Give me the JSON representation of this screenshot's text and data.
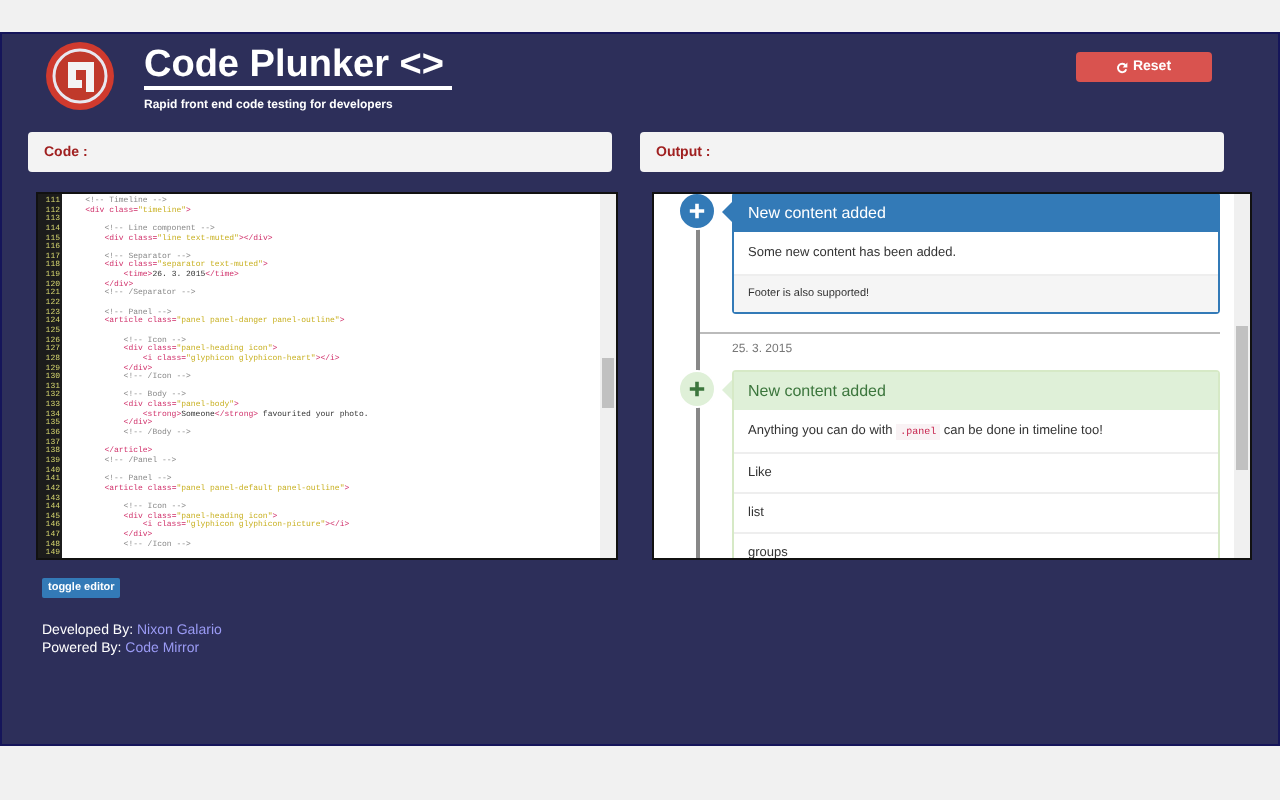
{
  "header": {
    "title": "Code Plunker <>",
    "subtitle": "Rapid front end code testing for developers",
    "reset_button": "Reset"
  },
  "sections": {
    "code_label": "Code :",
    "output_label": "Output :"
  },
  "editor": {
    "lines": [
      {
        "number": "111",
        "tokens": [
          {
            "kind": "comment",
            "text": "    <!-- Timeline -->"
          }
        ]
      },
      {
        "number": "112",
        "tokens": [
          {
            "kind": "tag",
            "text": "    <div "
          },
          {
            "kind": "attr",
            "text": "class="
          },
          {
            "kind": "string",
            "text": "\"timeline\""
          },
          {
            "kind": "tag",
            "text": ">"
          }
        ]
      },
      {
        "number": "113"
      },
      {
        "number": "114",
        "tokens": [
          {
            "kind": "comment",
            "text": "        <!-- Line component -->"
          }
        ]
      },
      {
        "number": "115",
        "tokens": [
          {
            "kind": "tag",
            "text": "        <div "
          },
          {
            "kind": "attr",
            "text": "class="
          },
          {
            "kind": "string",
            "text": "\"line text-muted\""
          },
          {
            "kind": "tag",
            "text": "></div>"
          }
        ]
      },
      {
        "number": "116"
      },
      {
        "number": "117",
        "tokens": [
          {
            "kind": "comment",
            "text": "        <!-- Separator -->"
          }
        ]
      },
      {
        "number": "118",
        "tokens": [
          {
            "kind": "tag",
            "text": "        <div "
          },
          {
            "kind": "attr",
            "text": "class="
          },
          {
            "kind": "string",
            "text": "\"separator text-muted\""
          },
          {
            "kind": "tag",
            "text": ">"
          }
        ]
      },
      {
        "number": "119",
        "tokens": [
          {
            "kind": "tag",
            "text": "            <time>"
          },
          {
            "kind": "text",
            "text": "26. 3. 2015"
          },
          {
            "kind": "tag",
            "text": "</time>"
          }
        ]
      },
      {
        "number": "120",
        "tokens": [
          {
            "kind": "tag",
            "text": "        </div>"
          }
        ]
      },
      {
        "number": "121",
        "tokens": [
          {
            "kind": "comment",
            "text": "        <!-- /Separator -->"
          }
        ]
      },
      {
        "number": "122"
      },
      {
        "number": "123",
        "tokens": [
          {
            "kind": "comment",
            "text": "        <!-- Panel -->"
          }
        ]
      },
      {
        "number": "124",
        "tokens": [
          {
            "kind": "tag",
            "text": "        <article "
          },
          {
            "kind": "attr",
            "text": "class="
          },
          {
            "kind": "string",
            "text": "\"panel panel-danger panel-outline\""
          },
          {
            "kind": "tag",
            "text": ">"
          }
        ]
      },
      {
        "number": "125"
      },
      {
        "number": "126",
        "tokens": [
          {
            "kind": "comment",
            "text": "            <!-- Icon -->"
          }
        ]
      },
      {
        "number": "127",
        "tokens": [
          {
            "kind": "tag",
            "text": "            <div "
          },
          {
            "kind": "attr",
            "text": "class="
          },
          {
            "kind": "string",
            "text": "\"panel-heading icon\""
          },
          {
            "kind": "tag",
            "text": ">"
          }
        ]
      },
      {
        "number": "128",
        "tokens": [
          {
            "kind": "tag",
            "text": "                <i "
          },
          {
            "kind": "attr",
            "text": "class="
          },
          {
            "kind": "string",
            "text": "\"glyphicon glyphicon-heart\""
          },
          {
            "kind": "tag",
            "text": "></i>"
          }
        ]
      },
      {
        "number": "129",
        "tokens": [
          {
            "kind": "tag",
            "text": "            </div>"
          }
        ]
      },
      {
        "number": "130",
        "tokens": [
          {
            "kind": "comment",
            "text": "            <!-- /Icon -->"
          }
        ]
      },
      {
        "number": "131"
      },
      {
        "number": "132",
        "tokens": [
          {
            "kind": "comment",
            "text": "            <!-- Body -->"
          }
        ]
      },
      {
        "number": "133",
        "tokens": [
          {
            "kind": "tag",
            "text": "            <div "
          },
          {
            "kind": "attr",
            "text": "class="
          },
          {
            "kind": "string",
            "text": "\"panel-body\""
          },
          {
            "kind": "tag",
            "text": ">"
          }
        ]
      },
      {
        "number": "134",
        "tokens": [
          {
            "kind": "tag",
            "text": "                <strong>"
          },
          {
            "kind": "text",
            "text": "Someone"
          },
          {
            "kind": "tag",
            "text": "</strong>"
          },
          {
            "kind": "text",
            "text": " favourited your photo."
          }
        ]
      },
      {
        "number": "135",
        "tokens": [
          {
            "kind": "tag",
            "text": "            </div>"
          }
        ]
      },
      {
        "number": "136",
        "tokens": [
          {
            "kind": "comment",
            "text": "            <!-- /Body -->"
          }
        ]
      },
      {
        "number": "137"
      },
      {
        "number": "138",
        "tokens": [
          {
            "kind": "tag",
            "text": "        </article>"
          }
        ]
      },
      {
        "number": "139",
        "tokens": [
          {
            "kind": "comment",
            "text": "        <!-- /Panel -->"
          }
        ]
      },
      {
        "number": "140"
      },
      {
        "number": "141",
        "tokens": [
          {
            "kind": "comment",
            "text": "        <!-- Panel -->"
          }
        ]
      },
      {
        "number": "142",
        "tokens": [
          {
            "kind": "tag",
            "text": "        <article "
          },
          {
            "kind": "attr",
            "text": "class="
          },
          {
            "kind": "string",
            "text": "\"panel panel-default panel-outline\""
          },
          {
            "kind": "tag",
            "text": ">"
          }
        ]
      },
      {
        "number": "143"
      },
      {
        "number": "144",
        "tokens": [
          {
            "kind": "comment",
            "text": "            <!-- Icon -->"
          }
        ]
      },
      {
        "number": "145",
        "tokens": [
          {
            "kind": "tag",
            "text": "            <div "
          },
          {
            "kind": "attr",
            "text": "class="
          },
          {
            "kind": "string",
            "text": "\"panel-heading icon\""
          },
          {
            "kind": "tag",
            "text": ">"
          }
        ]
      },
      {
        "number": "146",
        "tokens": [
          {
            "kind": "tag",
            "text": "                <i "
          },
          {
            "kind": "attr",
            "text": "class="
          },
          {
            "kind": "string",
            "text": "\"glyphicon glyphicon-picture\""
          },
          {
            "kind": "tag",
            "text": "></i>"
          }
        ]
      },
      {
        "number": "147",
        "tokens": [
          {
            "kind": "tag",
            "text": "            </div>"
          }
        ]
      },
      {
        "number": "148",
        "tokens": [
          {
            "kind": "comment",
            "text": "            <!-- /Icon -->"
          }
        ]
      },
      {
        "number": "149"
      }
    ]
  },
  "output": {
    "items": [
      {
        "kind": "infopanel",
        "heading": "New content added",
        "body": [
          {
            "kind": "text",
            "text": "Some new content has been added."
          }
        ],
        "footer": "Footer is also supported!"
      },
      {
        "kind": "separator",
        "date": "25. 3. 2015"
      },
      {
        "kind": "successpanel",
        "heading": "New content added",
        "body": [
          {
            "kind": "text",
            "text": "Anything you can do with "
          },
          {
            "kind": "code",
            "text": ".panel"
          },
          {
            "kind": "text",
            "text": " can be done in timeline too!"
          }
        ],
        "list": [
          "Like",
          "list",
          "groups"
        ]
      }
    ]
  },
  "toggle_button": "toggle editor",
  "credits": [
    {
      "label": "Developed By:",
      "link": "Nixon Galario"
    },
    {
      "label": "Powered By:",
      "link": "Code Mirror"
    }
  ]
}
